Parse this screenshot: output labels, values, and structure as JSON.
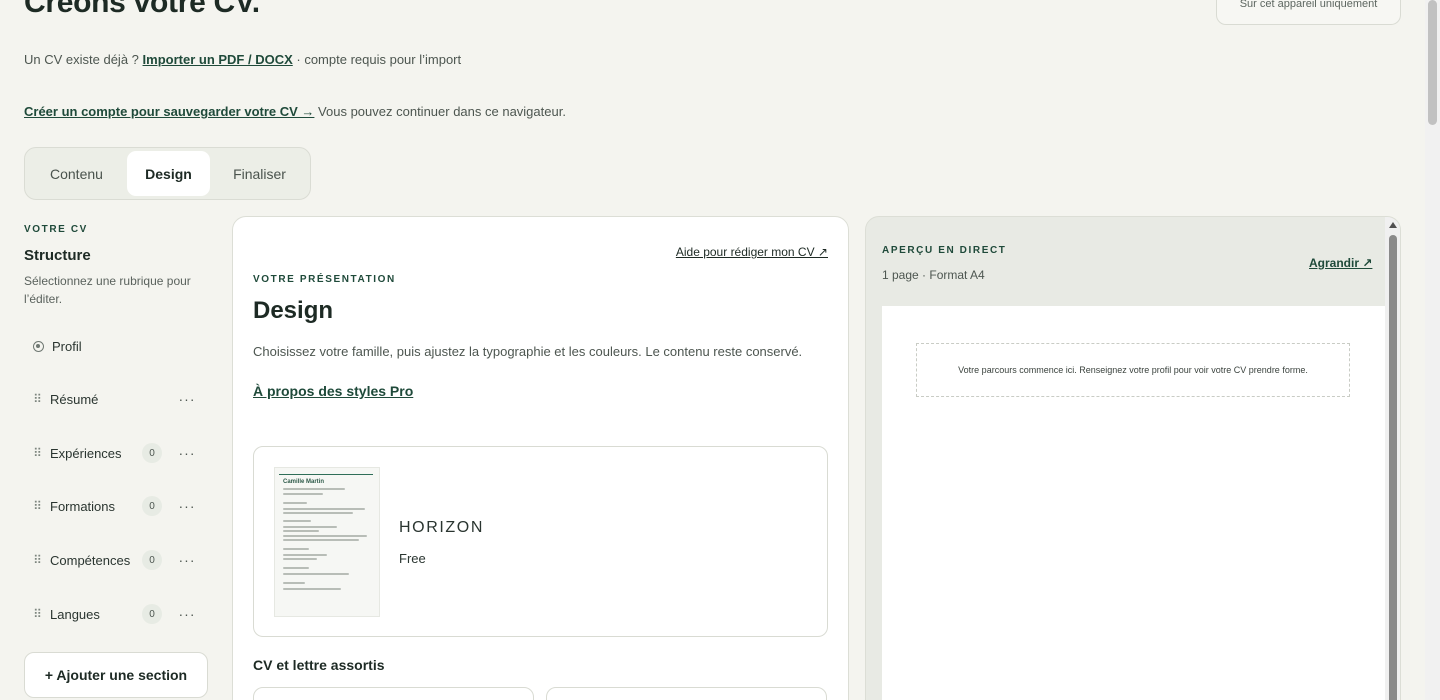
{
  "header": {
    "title": "Créons votre CV.",
    "device_badge": "Sur cet appareil uniquement"
  },
  "import": {
    "prefix": "Un CV existe déjà ?",
    "link": "Importer un PDF / DOCX",
    "suffix": "· compte requis pour l’import"
  },
  "account": {
    "link": "Créer un compte pour sauvegarder votre CV →",
    "suffix": "Vous pouvez continuer dans ce navigateur."
  },
  "tabs": [
    {
      "label": "Contenu",
      "active": false
    },
    {
      "label": "Design",
      "active": true
    },
    {
      "label": "Finaliser",
      "active": false
    }
  ],
  "sidebar": {
    "eyebrow": "VOTRE CV",
    "title": "Structure",
    "description": "Sélectionnez une rubrique pour l’éditer.",
    "items": [
      {
        "label": "Profil"
      },
      {
        "label": "Résumé",
        "more": "···"
      },
      {
        "label": "Expériences",
        "count": "0",
        "more": "···"
      },
      {
        "label": "Formations",
        "count": "0",
        "more": "···"
      },
      {
        "label": "Compétences",
        "count": "0",
        "more": "···"
      },
      {
        "label": "Langues",
        "count": "0",
        "more": "···"
      }
    ],
    "add_section": "+ Ajouter une section"
  },
  "design": {
    "help_link": "Aide pour rédiger mon CV ↗",
    "eyebrow": "VOTRE PRÉSENTATION",
    "title": "Design",
    "description": "Choisissez votre famille, puis ajustez la typographie et les couleurs. Le contenu reste conservé.",
    "pro_link": "À propos des styles Pro",
    "template": {
      "name": "HORIZON",
      "tier": "Free",
      "thumbnail_name": "Camille Martin"
    },
    "matching_title": "CV et lettre assortis"
  },
  "preview": {
    "eyebrow": "APERÇU EN DIRECT",
    "meta": "1 page · Format A4",
    "enlarge": "Agrandir ↗",
    "placeholder": "Votre parcours commence ici. Renseignez votre profil pour voir votre CV prendre forme."
  },
  "colors": {
    "accent": "#1f4a3a",
    "background": "#f4f4ef"
  }
}
